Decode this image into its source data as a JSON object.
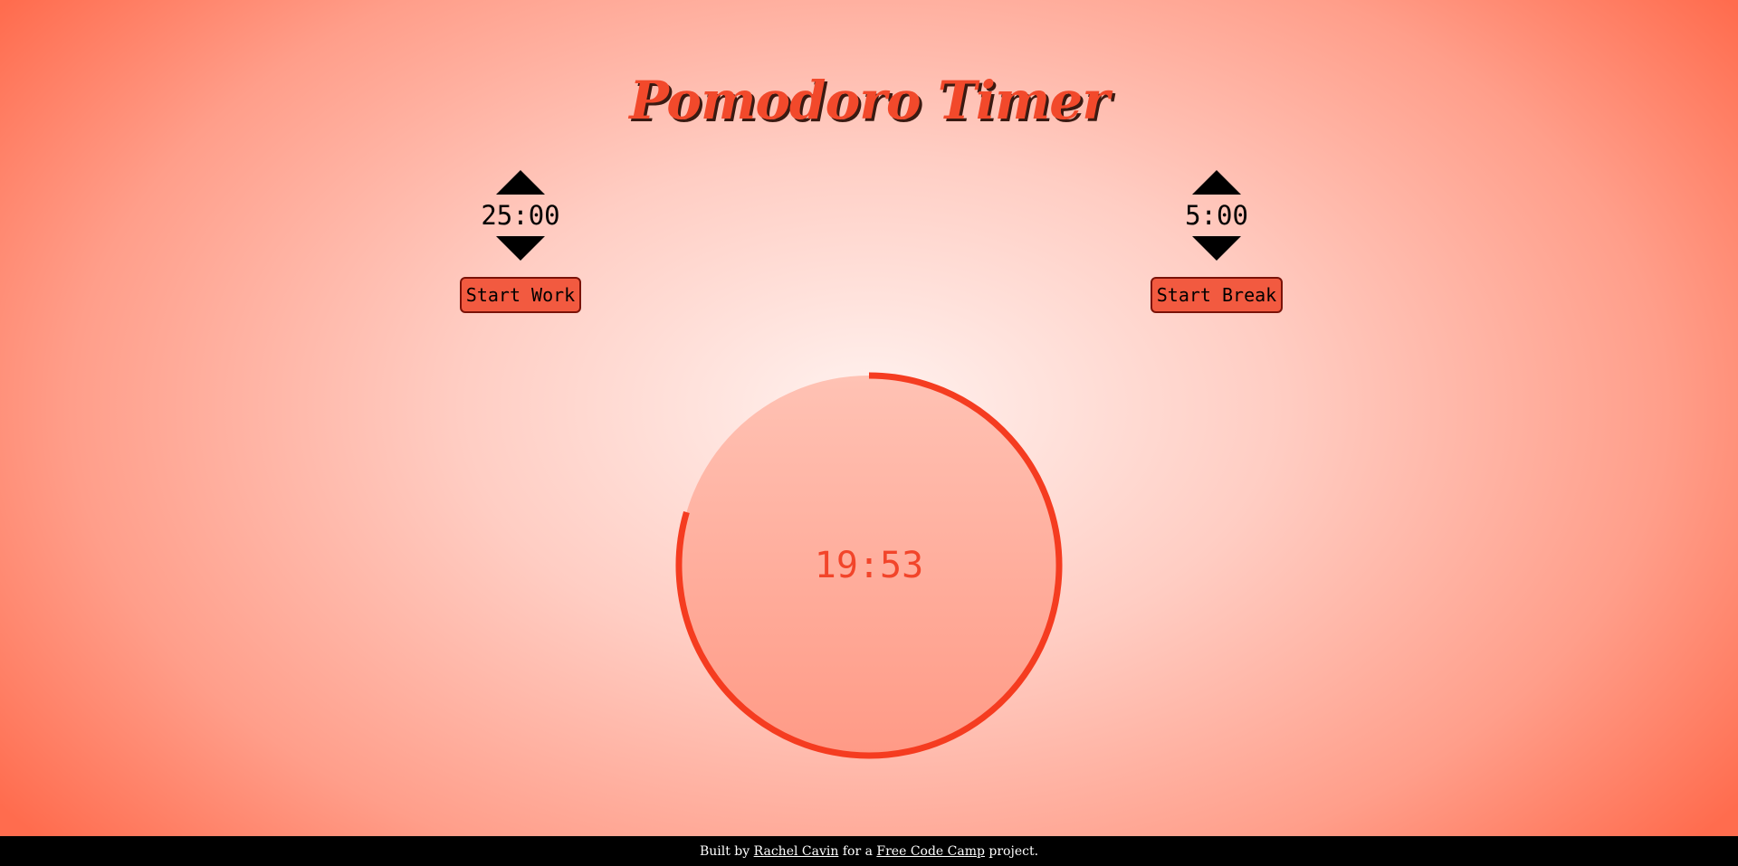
{
  "title": "Pomodoro Timer",
  "work": {
    "time": "25:00",
    "button_label": "Start Work"
  },
  "break": {
    "time": "5:00",
    "button_label": "Start Break"
  },
  "timer": {
    "remaining": "19:53",
    "progress_elapsed_fraction": 0.2047,
    "ring_color": "#f53c20",
    "fill_color": "#ffa492"
  },
  "footer": {
    "prefix": "Built by",
    "author_link": "Rachel Cavin",
    "middle": "for a",
    "project_link": "Free Code Camp",
    "suffix": "project."
  },
  "colors": {
    "accent": "#f2492b",
    "button_bg": "#f25a40"
  },
  "icons": {
    "increase": "triangle-up-icon",
    "decrease": "triangle-down-icon"
  }
}
